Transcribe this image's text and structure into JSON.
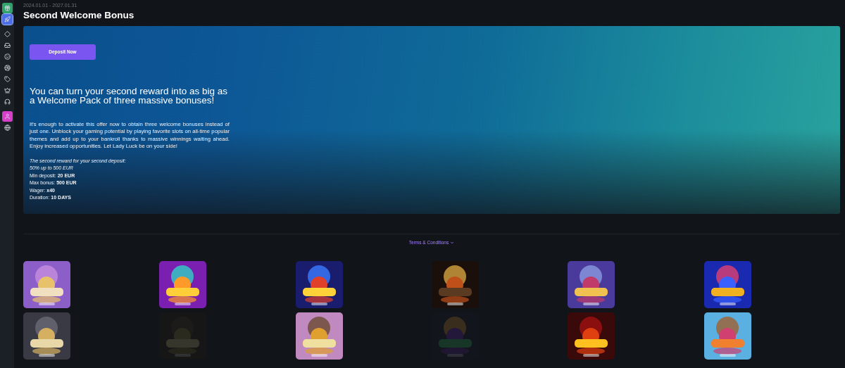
{
  "sidebar": {
    "items": [
      {
        "color": "#2fa36b",
        "selected": false
      },
      {
        "color": "#4c6ee6",
        "selected": true
      },
      {
        "selected": false
      },
      {
        "selected": false
      },
      {
        "selected": false
      },
      {
        "selected": false
      },
      {
        "selected": false
      },
      {
        "selected": false
      },
      {
        "selected": false
      },
      {
        "color": "#d63fc8",
        "selected": false
      },
      {
        "selected": false
      }
    ]
  },
  "header": {
    "dates": "2024.01.01 - 2027.01.31",
    "title": "Second Welcome Bonus"
  },
  "hero": {
    "button": "Deposit Now",
    "heading": "You can turn your second reward into as big as a Welcome Pack of three massive bonuses!",
    "paragraph": "It's enough to activate this offer now to obtain three welcome bonuses instead of just one. Unblock your gaming potential by playing favorite slots on all-time popular themes and add up to your bankroll thanks to massive winnings waiting ahead. Enjoy increased opportunities. Let Lady Luck be on your side!",
    "details": [
      {
        "text": "The second reward for your second deposit:",
        "italic": true
      },
      {
        "text": "50% up to 500 EUR",
        "italic": true
      },
      {
        "text": "Min deposit: **20 EUR**",
        "italic": false
      },
      {
        "text": "Max bonus: **500 EUR**",
        "italic": false
      },
      {
        "text": "Wager: **x40**",
        "italic": false
      },
      {
        "text": "Duration: **10 DAYS**",
        "italic": false
      }
    ]
  },
  "terms_link": {
    "label": "Terms & Conditions",
    "expanded": false
  },
  "games": [
    {
      "kind": "picture",
      "dimmed": false
    },
    {
      "kind": "picture",
      "dimmed": false
    },
    {
      "kind": "picture",
      "dimmed": false
    },
    {
      "kind": "picture",
      "dimmed": false
    },
    {
      "kind": "picture",
      "dimmed": false
    },
    {
      "kind": "picture",
      "dimmed": false
    },
    {
      "kind": "picture",
      "dimmed": false
    },
    {
      "kind": "picture",
      "dimmed": true
    },
    {
      "kind": "picture",
      "dimmed": false
    },
    {
      "kind": "picture",
      "dimmed": true
    },
    {
      "kind": "picture",
      "dimmed": false
    },
    {
      "kind": "picture",
      "dimmed": false
    }
  ]
}
